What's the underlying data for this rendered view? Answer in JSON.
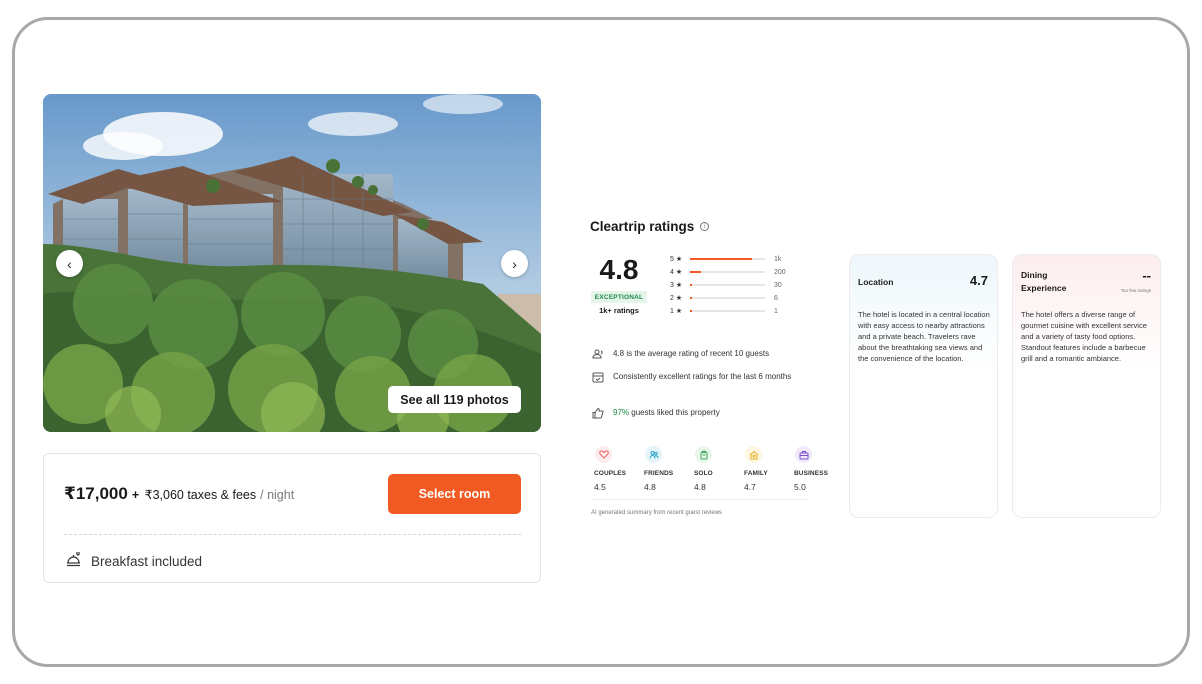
{
  "gallery": {
    "see_all_label": "See all 119 photos",
    "prev_icon": "chevron-left-icon",
    "next_icon": "chevron-right-icon"
  },
  "pricing": {
    "price": "₹17,000",
    "plus": "+",
    "taxes": "₹3,060 taxes & fees",
    "per_night": "/ night",
    "select_button": "Select room",
    "amenity_icon": "breakfast-tray-icon",
    "amenity": "Breakfast included",
    "accent_color": "#f15a22"
  },
  "ratings": {
    "title": "Cleartrip ratings",
    "info_icon": "info-icon",
    "score": "4.8",
    "badge": "EXCEPTIONAL",
    "badge_color": "#1a8a44",
    "count": "1k+ ratings",
    "distribution": [
      {
        "stars": "5 ★",
        "count": "1k",
        "fraction": 0.83
      },
      {
        "stars": "4 ★",
        "count": "200",
        "fraction": 0.15
      },
      {
        "stars": "3 ★",
        "count": "30",
        "fraction": 0.02
      },
      {
        "stars": "2 ★",
        "count": "6",
        "fraction": 0.01
      },
      {
        "stars": "1 ★",
        "count": "1",
        "fraction": 0.005
      }
    ],
    "insights": [
      {
        "icon": "guests-icon",
        "text": "4.8 is the average rating of recent 10 guests"
      },
      {
        "icon": "calendar-check-icon",
        "text": "Consistently excellent ratings for the last 6 months"
      },
      {
        "icon": "thumbs-up-icon",
        "pct": "97%",
        "text": " guests liked this property"
      }
    ],
    "segments": [
      {
        "icon": "heart-icon",
        "label": "COUPLES",
        "value": "4.5",
        "color": "#f06b6b",
        "bg": "#fdeeee"
      },
      {
        "icon": "friends-icon",
        "label": "FRIENDS",
        "value": "4.8",
        "color": "#2ea6c9",
        "bg": "#e6f5fa"
      },
      {
        "icon": "solo-icon",
        "label": "SOLO",
        "value": "4.8",
        "color": "#3aa657",
        "bg": "#e8f6ec"
      },
      {
        "icon": "family-icon",
        "label": "FAMILY",
        "value": "4.7",
        "color": "#e2b022",
        "bg": "#fdf6e0"
      },
      {
        "icon": "briefcase-icon",
        "label": "BUSINESS",
        "value": "5.0",
        "color": "#7b4fcf",
        "bg": "#f0eafb"
      }
    ],
    "ai_note": "AI generated summary from recent guest reviews"
  },
  "categories": [
    {
      "name": "Location",
      "score": "4.7",
      "description": "The hotel is located in a central location with easy access to nearby attractions and a private beach. Travelers rave about the breathtaking sea views and the convenience of the location."
    },
    {
      "name": "Dining Experience",
      "score": "--",
      "sub": "Too few ratings",
      "description": "The hotel offers a diverse range of gourmet cuisine with excellent service and a variety of tasty food options. Standout features include a barbecue grill and a romantic ambiance."
    }
  ]
}
